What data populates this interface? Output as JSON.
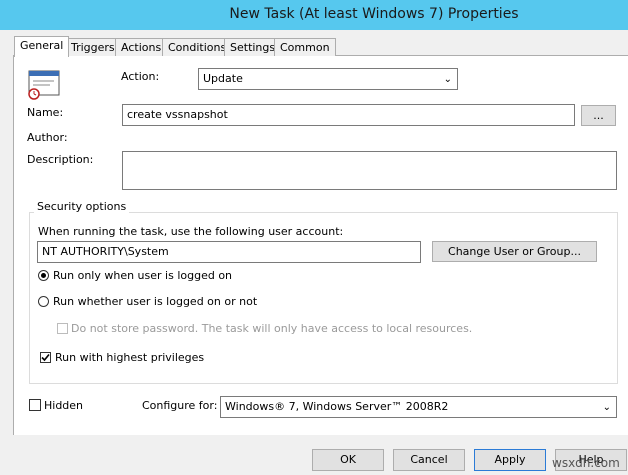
{
  "window": {
    "title": "New Task (At least Windows 7) Properties"
  },
  "tabs": [
    {
      "label": "General"
    },
    {
      "label": "Triggers"
    },
    {
      "label": "Actions"
    },
    {
      "label": "Conditions"
    },
    {
      "label": "Settings"
    },
    {
      "label": "Common"
    }
  ],
  "general": {
    "action_label": "Action:",
    "action_value": "Update",
    "name_label": "Name:",
    "name_value": "create vssnapshot",
    "browse_label": "...",
    "author_label": "Author:",
    "description_label": "Description:",
    "description_value": ""
  },
  "security": {
    "group_label": "Security options",
    "account_prompt": "When running the task, use the following user account:",
    "account_value": "NT AUTHORITY\\System",
    "change_button": "Change User or Group...",
    "run_logged_on": "Run only when user is logged on",
    "run_whether": "Run whether user is logged on or not",
    "no_store_password": "Do not store password. The task will only have access to local resources.",
    "highest_privileges": "Run with highest privileges"
  },
  "bottom": {
    "hidden_label": "Hidden",
    "configure_label": "Configure for:",
    "configure_value": "Windows® 7, Windows Server™ 2008R2"
  },
  "buttons": {
    "ok": "OK",
    "cancel": "Cancel",
    "apply": "Apply",
    "help": "Help"
  },
  "watermark": "wsxdn.com"
}
